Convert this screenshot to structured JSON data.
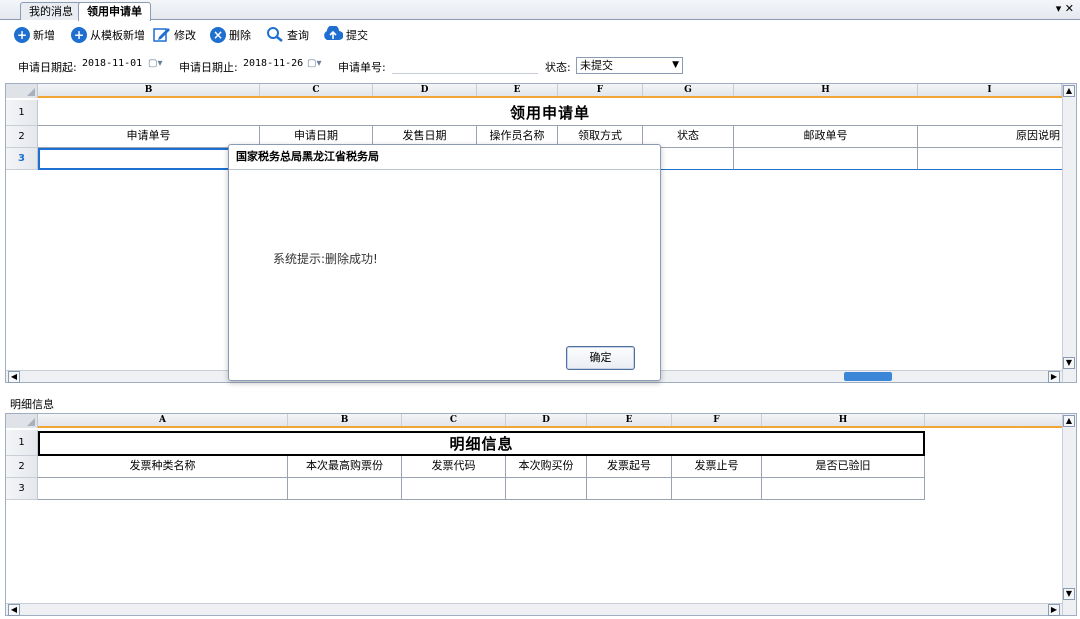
{
  "tabs": [
    {
      "label": "我的消息",
      "active": false
    },
    {
      "label": "领用申请单",
      "active": true
    }
  ],
  "window_controls": "▾ ✕",
  "toolbar": {
    "new": "新增",
    "new_from_template": "从模板新增",
    "edit": "修改",
    "delete": "删除",
    "query": "查询",
    "submit": "提交"
  },
  "filters": {
    "date_from_label": "申请日期起:",
    "date_from_value": "2018-11-01",
    "date_to_label": "申请日期止:",
    "date_to_value": "2018-11-26",
    "app_no_label": "申请单号:",
    "app_no_value": "",
    "status_label": "状态:",
    "status_value": "未提交"
  },
  "top_grid": {
    "col_letters": [
      "B",
      "C",
      "D",
      "E",
      "F",
      "G",
      "H",
      "I"
    ],
    "row_numbers": [
      "1",
      "2",
      "3"
    ],
    "title": "领用申请单",
    "headers": [
      "申请单号",
      "申请日期",
      "发售日期",
      "操作员名称",
      "领取方式",
      "状态",
      "邮政单号",
      "原因说明"
    ]
  },
  "section_label": "明细信息",
  "bottom_grid": {
    "col_letters": [
      "A",
      "B",
      "C",
      "D",
      "E",
      "F",
      "H"
    ],
    "row_numbers": [
      "1",
      "2",
      "3"
    ],
    "title": "明细信息",
    "headers": [
      "发票种类名称",
      "本次最高购票份",
      "发票代码",
      "本次购买份",
      "发票起号",
      "发票止号",
      "是否已验旧"
    ]
  },
  "dialog": {
    "title": "国家税务总局黑龙江省税务局",
    "message": "系统提示:删除成功!",
    "ok_label": "确定"
  },
  "colors": {
    "header_accent": "#f0a537",
    "toolbar_icon_blue": "#1e6fd0",
    "grid_border": "#9aa3b0"
  }
}
